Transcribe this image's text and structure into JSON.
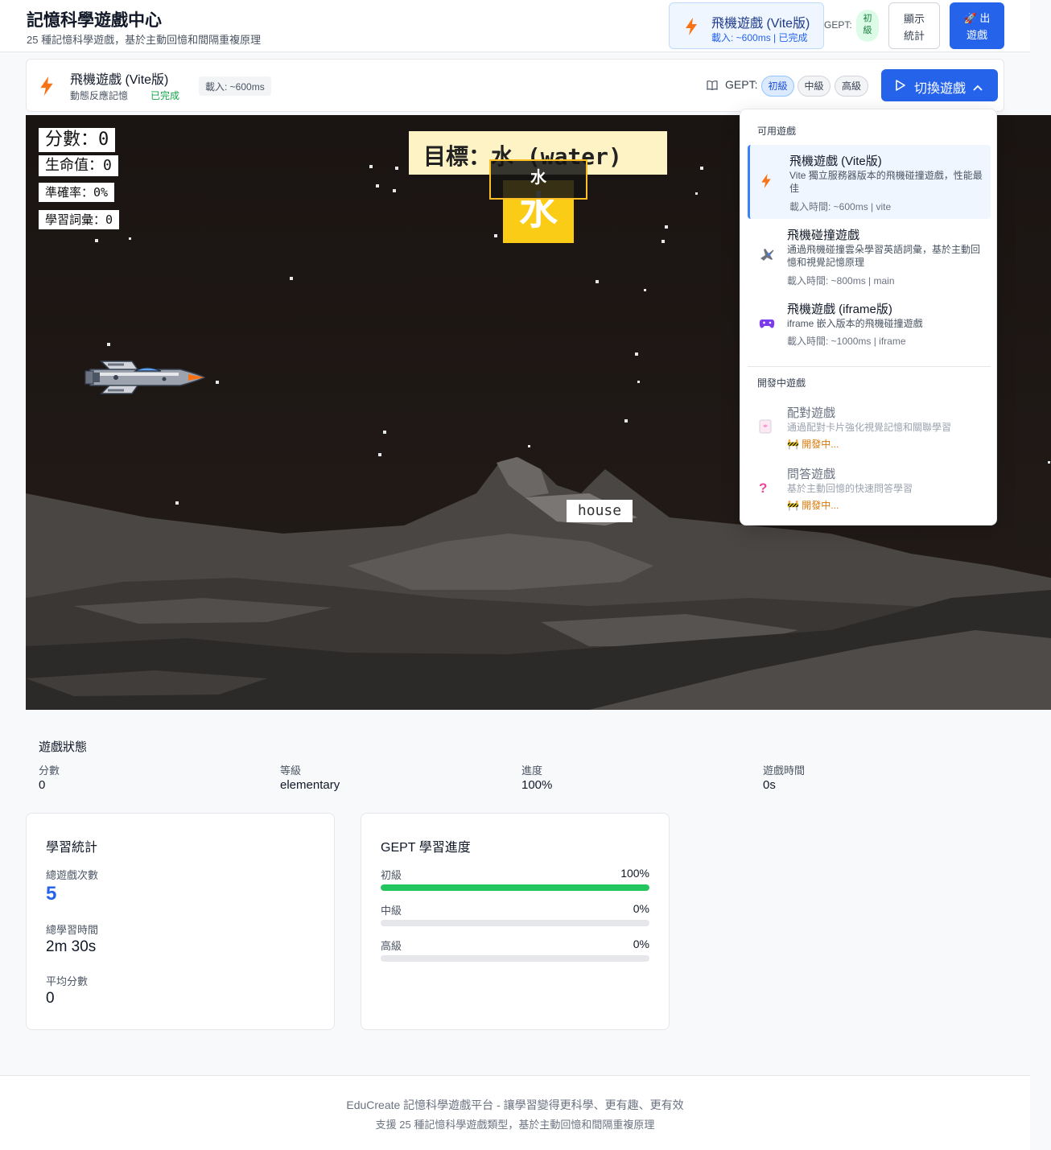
{
  "header": {
    "title": "記憶科學遊戲中心",
    "subtitle": "25 種記憶科學遊戲，基於主動回憶和間隔重複原理",
    "current_game": {
      "name": "飛機遊戲 (Vite版)",
      "meta": "載入: ~600ms | 已完成",
      "icon": "bolt-icon"
    },
    "gept_label": "GEPT:",
    "gept_level": "初級",
    "stats_button": "顯示統計",
    "exit_button": "🚀 出遊戲"
  },
  "switcher": {
    "game_name": "飛機遊戲 (Vite版)",
    "game_desc": "動態反應記憶",
    "status": "已完成",
    "load_time": "載入: ~600ms",
    "gept_label": "GEPT:",
    "levels": [
      "初級",
      "中級",
      "高級"
    ],
    "active_level": "初級",
    "switch_button": "切換遊戲"
  },
  "game": {
    "hud": {
      "score_label": "分數：",
      "score": "0",
      "lives_label": "生命值：",
      "lives": "0",
      "accuracy_label": "準確率：",
      "accuracy": "0%",
      "vocab_label": "學習詞彙：",
      "vocab": "0"
    },
    "target": "目標：水 (water)",
    "target_char_label": "水",
    "target_char_tile": "水",
    "floating_word": "house"
  },
  "dropdown": {
    "section_available": "可用遊戲",
    "available": [
      {
        "title": "飛機遊戲 (Vite版)",
        "desc": "Vite 獨立服務器版本的飛機碰撞遊戲，性能最佳",
        "meta": "載入時間: ~600ms | vite",
        "icon": "bolt-icon"
      },
      {
        "title": "飛機碰撞遊戲",
        "desc": "通過飛機碰撞雲朵學習英語詞彙，基於主動回憶和視覺記憶原理",
        "meta": "載入時間: ~800ms | main",
        "icon": "airplane-icon"
      },
      {
        "title": "飛機遊戲 (iframe版)",
        "desc": "iframe 嵌入版本的飛機碰撞遊戲",
        "meta": "載入時間: ~1000ms | iframe",
        "icon": "gamepad-icon"
      }
    ],
    "section_dev": "開發中遊戲",
    "dev": [
      {
        "title": "配對遊戲",
        "desc": "通過配對卡片強化視覺記憶和關聯學習",
        "meta": "🚧 開發中...",
        "icon": "card-icon"
      },
      {
        "title": "問答遊戲",
        "desc": "基於主動回憶的快速問答學習",
        "meta": "🚧 開發中...",
        "icon": "question-icon"
      }
    ]
  },
  "status": {
    "title": "遊戲狀態",
    "items": [
      {
        "label": "分數",
        "value": "0"
      },
      {
        "label": "等級",
        "value": "elementary"
      },
      {
        "label": "進度",
        "value": "100%"
      },
      {
        "label": "遊戲時間",
        "value": "0s"
      }
    ]
  },
  "learning_stats": {
    "title": "學習統計",
    "total_games_label": "總遊戲次數",
    "total_games": "5",
    "total_time_label": "總學習時間",
    "total_time": "2m 30s",
    "avg_score_label": "平均分數",
    "avg_score": "0"
  },
  "gept_progress": {
    "title": "GEPT 學習進度",
    "levels": [
      {
        "label": "初級",
        "pct_text": "100%",
        "pct": 100
      },
      {
        "label": "中級",
        "pct_text": "0%",
        "pct": 0
      },
      {
        "label": "高級",
        "pct_text": "0%",
        "pct": 0
      }
    ]
  },
  "footer": {
    "line1": "EduCreate 記憶科學遊戲平台 - 讓學習變得更科學、更有趣、更有效",
    "line2": "支援 25 種記憶科學遊戲類型，基於主動回憶和間隔重複原理"
  },
  "colors": {
    "primary": "#2563eb",
    "success": "#22c55e",
    "accent_bolt": "#f97316",
    "game_bg": "#1c1614",
    "tile_yellow": "#facc15"
  }
}
